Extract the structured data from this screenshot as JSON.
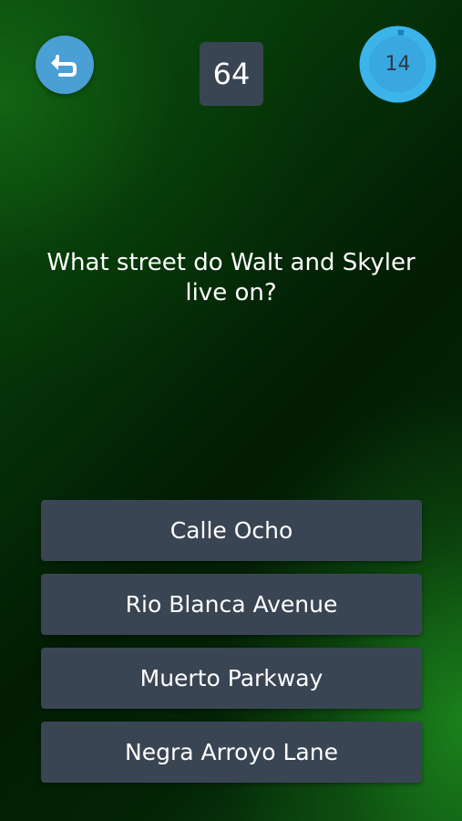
{
  "header": {
    "back_icon": "undo-arrow-icon",
    "question_number": "64",
    "timer": {
      "value": "14",
      "remaining_fraction": 0.97
    }
  },
  "question": {
    "text": "What street do Walt and Skyler live on?"
  },
  "answers": [
    {
      "label": "Calle Ocho"
    },
    {
      "label": "Rio Blanca Avenue"
    },
    {
      "label": "Muerto Parkway"
    },
    {
      "label": "Negra Arroyo Lane"
    }
  ],
  "colors": {
    "accent_blue": "#4a9fd4",
    "timer_blue": "#3bb4ec",
    "card": "#3a4554"
  }
}
